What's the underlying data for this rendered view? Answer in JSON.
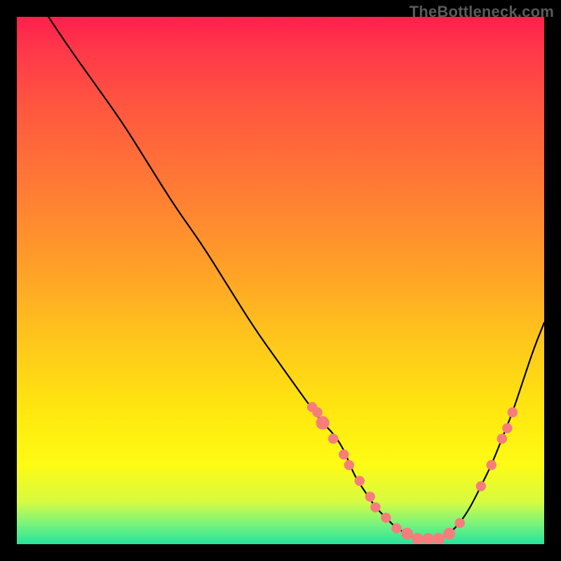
{
  "watermark": "TheBottleneck.com",
  "chart_data": {
    "type": "line",
    "title": "",
    "xlabel": "",
    "ylabel": "",
    "xlim": [
      0,
      100
    ],
    "ylim": [
      0,
      100
    ],
    "grid": false,
    "legend": false,
    "series": [
      {
        "name": "curve",
        "x": [
          6,
          10,
          15,
          20,
          25,
          30,
          35,
          40,
          45,
          50,
          55,
          58,
          60,
          62,
          64,
          66,
          68,
          70,
          72,
          74,
          76,
          78,
          80,
          82,
          84,
          86,
          88,
          90,
          92,
          94,
          96,
          98,
          100
        ],
        "y": [
          100,
          94,
          87,
          80,
          72,
          64,
          57,
          49,
          41,
          34,
          27,
          23,
          21,
          18,
          13,
          10,
          7,
          5,
          3,
          2,
          1,
          1,
          1,
          2,
          4,
          7,
          11,
          15,
          20,
          25,
          31,
          37,
          42
        ]
      }
    ],
    "markers": [
      {
        "x": 56,
        "y": 26,
        "r": 1.2
      },
      {
        "x": 57,
        "y": 25,
        "r": 1.2
      },
      {
        "x": 58,
        "y": 23,
        "r": 1.6
      },
      {
        "x": 60,
        "y": 20,
        "r": 1.2
      },
      {
        "x": 62,
        "y": 17,
        "r": 1.2
      },
      {
        "x": 63,
        "y": 15,
        "r": 1.2
      },
      {
        "x": 65,
        "y": 12,
        "r": 1.2
      },
      {
        "x": 67,
        "y": 9,
        "r": 1.2
      },
      {
        "x": 68,
        "y": 7,
        "r": 1.2
      },
      {
        "x": 70,
        "y": 5,
        "r": 1.2
      },
      {
        "x": 72,
        "y": 3,
        "r": 1.2
      },
      {
        "x": 74,
        "y": 2,
        "r": 1.4
      },
      {
        "x": 76,
        "y": 1,
        "r": 1.4
      },
      {
        "x": 78,
        "y": 1,
        "r": 1.4
      },
      {
        "x": 80,
        "y": 1,
        "r": 1.4
      },
      {
        "x": 82,
        "y": 2,
        "r": 1.4
      },
      {
        "x": 84,
        "y": 4,
        "r": 1.2
      },
      {
        "x": 88,
        "y": 11,
        "r": 1.2
      },
      {
        "x": 90,
        "y": 15,
        "r": 1.2
      },
      {
        "x": 92,
        "y": 20,
        "r": 1.2
      },
      {
        "x": 93,
        "y": 22,
        "r": 1.2
      },
      {
        "x": 94,
        "y": 25,
        "r": 1.2
      }
    ]
  },
  "colors": {
    "curve_stroke": "#000000",
    "marker_fill": "#f77d7d"
  }
}
